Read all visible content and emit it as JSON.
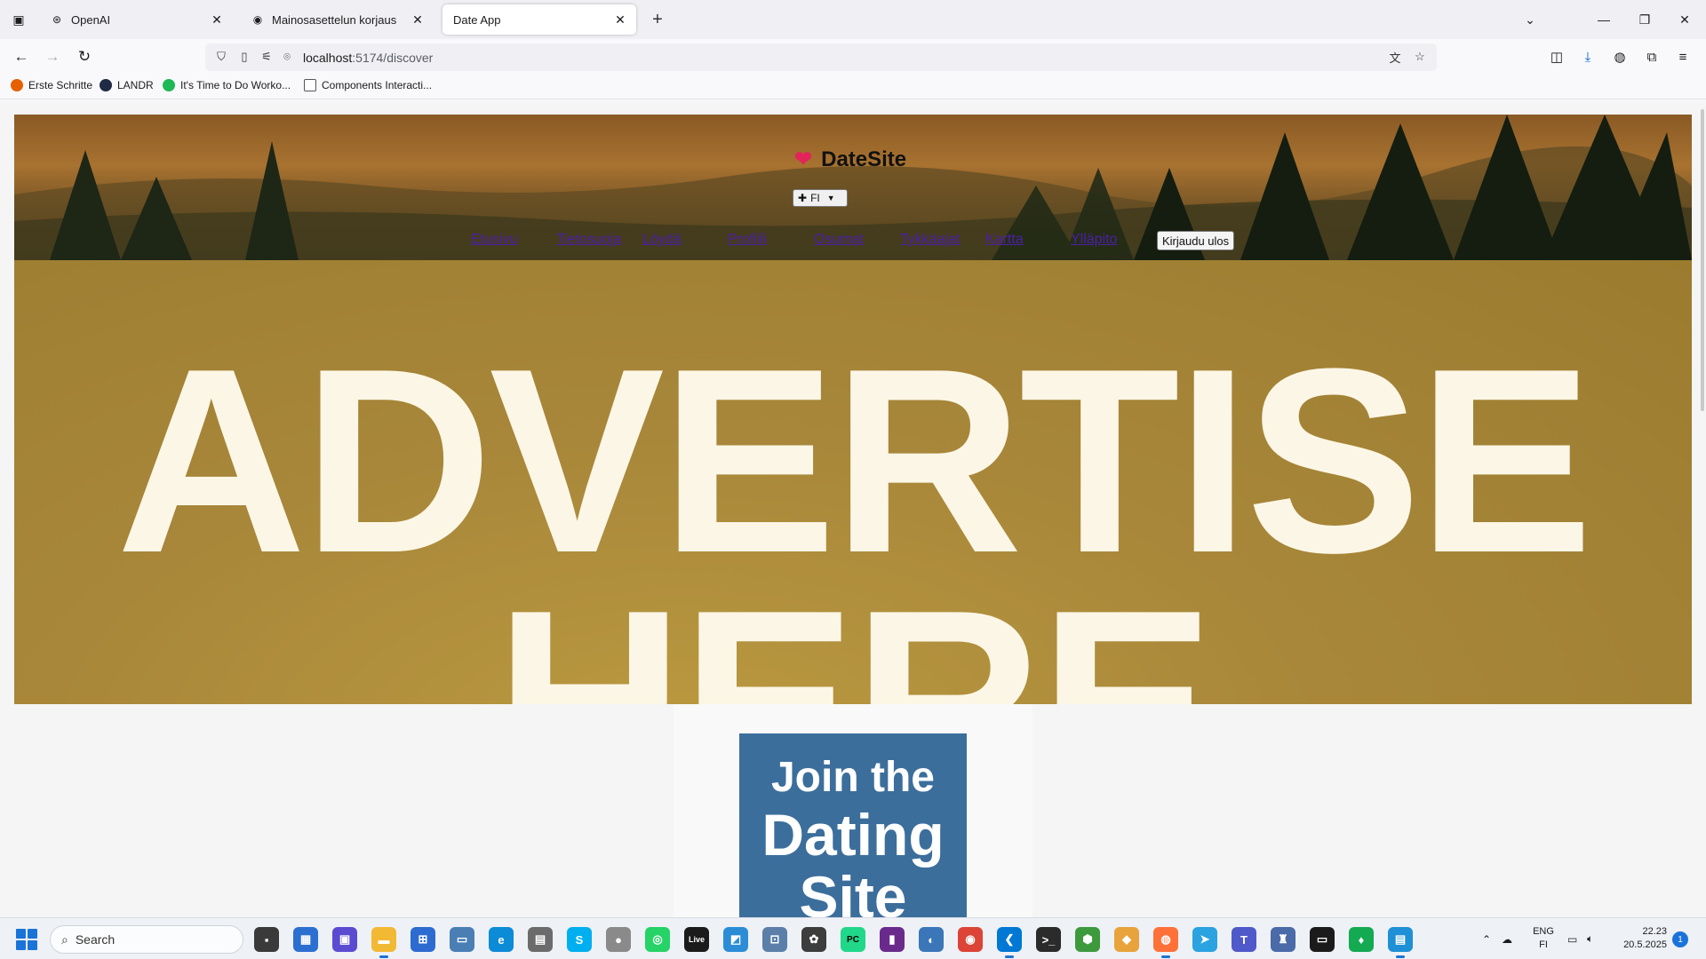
{
  "browser": {
    "tabs": [
      {
        "title": "OpenAI",
        "active": false
      },
      {
        "title": "Mainosasettelun korjaus",
        "active": false
      },
      {
        "title": "Date App",
        "active": true
      }
    ],
    "url": {
      "host": "localhost",
      "path": ":5174/discover"
    },
    "bookmarks": [
      {
        "label": "Erste Schritte",
        "icon": "firefox-icon",
        "color": "#e66000"
      },
      {
        "label": "LANDR",
        "icon": "landr-icon",
        "color": "#1f2b44"
      },
      {
        "label": "It's Time to Do Worko...",
        "icon": "spotify-icon",
        "color": "#1db954"
      },
      {
        "label": "Components Interacti...",
        "icon": "doc-icon",
        "color": "#555555"
      }
    ]
  },
  "site": {
    "brand": "DateSite",
    "language": "FI",
    "nav": [
      "Etusivu",
      "Tietosuoja",
      "Löydä",
      "Profiili",
      "Osumat",
      "Tykkäajat",
      "Kartta",
      "Ylläpito"
    ],
    "logout_label": "Kirjaudu ulos"
  },
  "ad": {
    "line1": "ADVERTISE",
    "line2": "HERE"
  },
  "promo": {
    "line1": "Join the",
    "line2": "Dating",
    "line3": "Site"
  },
  "taskbar": {
    "search_label": "Search",
    "lang_top": "ENG",
    "lang_bottom": "FI",
    "time": "22.23",
    "date": "20.5.2025",
    "notification_count": "1"
  },
  "colors": {
    "promo_bg": "#3c6e9c",
    "ad_text": "#fcf6e6",
    "link": "#4b1fa8",
    "heart": "#e2245a"
  }
}
